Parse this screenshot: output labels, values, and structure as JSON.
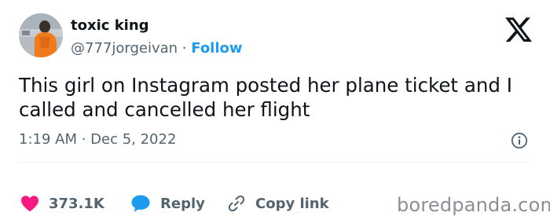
{
  "author": {
    "display_name": "toxic king",
    "handle": "@777jorgeivan",
    "separator": "·",
    "follow_label": "Follow"
  },
  "brand_logo": "x-logo-icon",
  "tweet": {
    "text": "This girl on Instagram posted her plane ticket and I called and cancelled her flight",
    "timestamp": "1:19 AM · Dec 5, 2022"
  },
  "actions": {
    "likes_count": "373.1K",
    "reply_label": "Reply",
    "copy_link_label": "Copy link"
  },
  "watermark": "boredpanda.com",
  "colors": {
    "like": "#f91880",
    "reply": "#1d9bf0",
    "follow": "#1d9bf0",
    "muted": "#536471"
  }
}
